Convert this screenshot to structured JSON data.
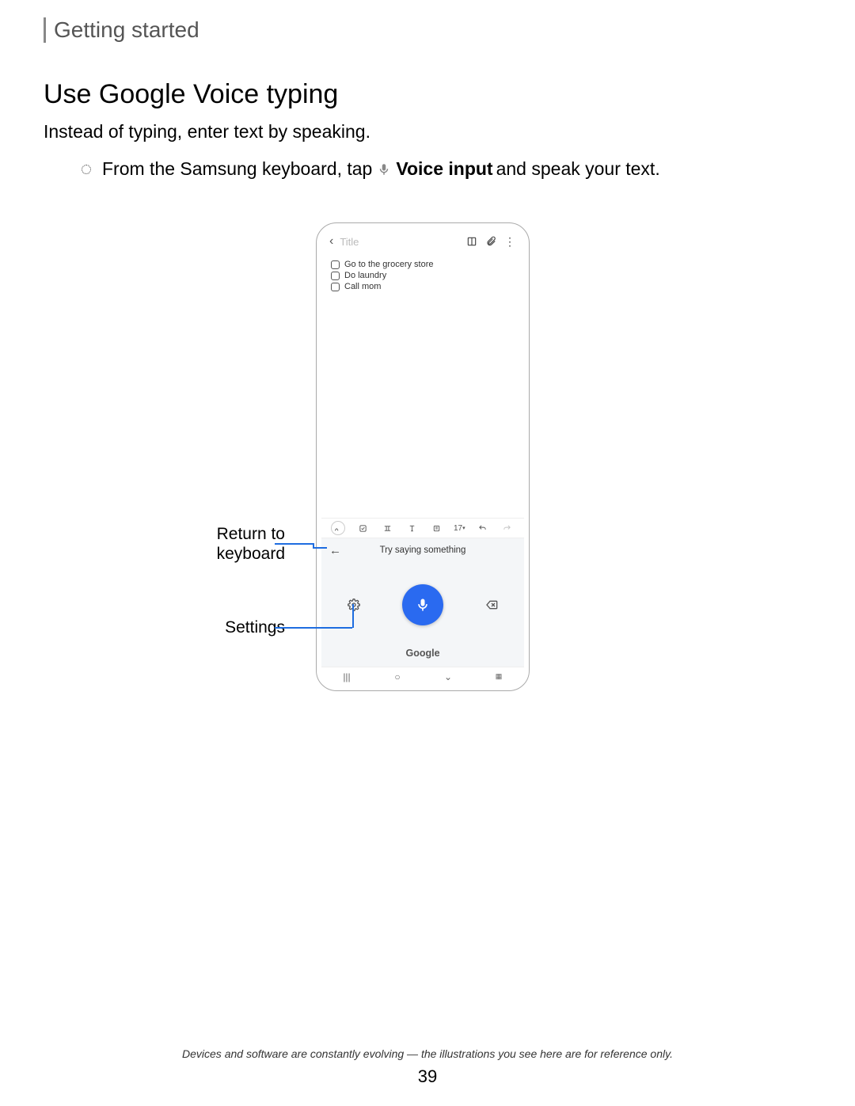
{
  "breadcrumb": "Getting started",
  "heading": "Use Google Voice typing",
  "intro": "Instead of typing, enter text by speaking.",
  "step": {
    "pre": "From the Samsung keyboard, tap",
    "label": "Voice input",
    "post": "and speak your text."
  },
  "phone": {
    "title_placeholder": "Title",
    "checklist": [
      "Go to the grocery store",
      "Do laundry",
      "Call mom"
    ],
    "toolbar": {
      "font_size": "17"
    },
    "voice": {
      "hint": "Try saying something",
      "brand": "Google"
    }
  },
  "callouts": {
    "return_kb_l1": "Return to",
    "return_kb_l2": "keyboard",
    "settings": "Settings"
  },
  "footer": "Devices and software are constantly evolving — the illustrations you see here are for reference only.",
  "page_number": "39"
}
